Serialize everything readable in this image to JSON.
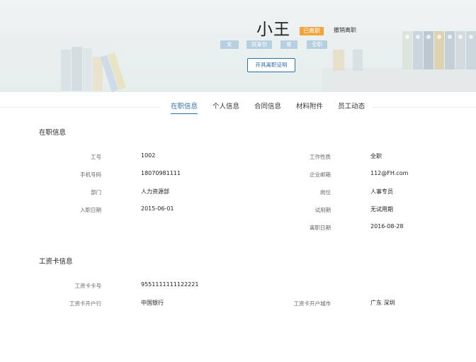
{
  "header": {
    "name": "小王",
    "status_badge": "已离职",
    "revoke_link": "撤销离职",
    "tags": [
      "女",
      "双身份",
      "是",
      "全职"
    ],
    "cert_button": "开具离职证明"
  },
  "tabs": [
    {
      "label": "在职信息",
      "active": true
    },
    {
      "label": "个人信息",
      "active": false
    },
    {
      "label": "合同信息",
      "active": false
    },
    {
      "label": "材料附件",
      "active": false
    },
    {
      "label": "员工动态",
      "active": false
    }
  ],
  "employment": {
    "title": "在职信息",
    "left": [
      {
        "label": "工号",
        "value": "1002"
      },
      {
        "label": "手机号码",
        "value": "18070981111"
      },
      {
        "label": "部门",
        "value": "人力资源部"
      },
      {
        "label": "入职日期",
        "value": "2015-06-01"
      }
    ],
    "right": [
      {
        "label": "工作性质",
        "value": "全职"
      },
      {
        "label": "企业邮箱",
        "value": "112@FH.com"
      },
      {
        "label": "岗位",
        "value": "人事专员"
      },
      {
        "label": "试用期",
        "value": "无试用期"
      },
      {
        "label": "离职日期",
        "value": "2016-08-28"
      }
    ]
  },
  "salary_card": {
    "title": "工资卡信息",
    "card_number_label": "工资卡卡号",
    "card_number": "9551111111122221",
    "bank_label": "工资卡开户行",
    "bank": "中国银行",
    "city_label": "工资卡开户城市",
    "city": "广东 深圳"
  },
  "colors": {
    "accent": "#2d6fa8",
    "badge": "#f2a33a",
    "tag": "#b7d0e1"
  }
}
